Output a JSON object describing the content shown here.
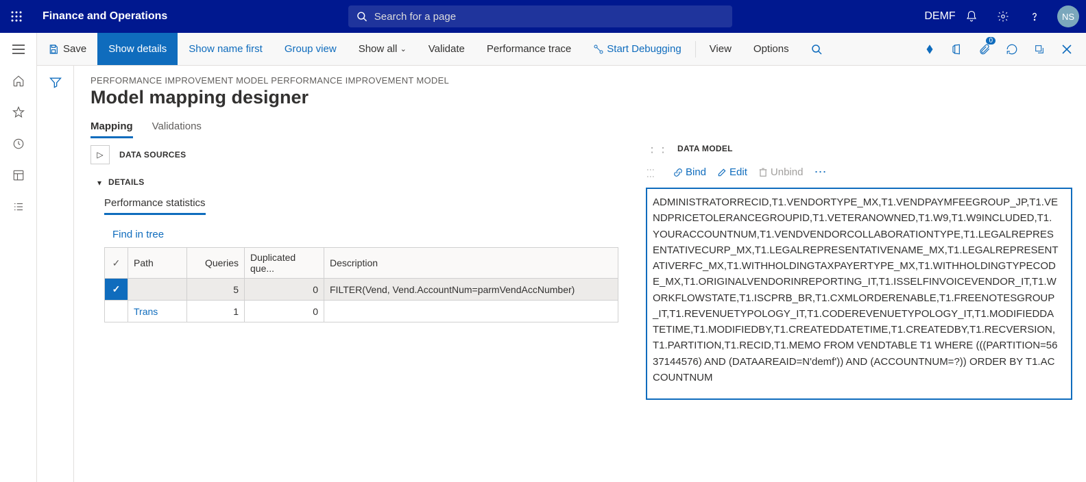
{
  "header": {
    "app_title": "Finance and Operations",
    "search_placeholder": "Search for a page",
    "company": "DEMF",
    "user_initials": "NS"
  },
  "commands": {
    "save": "Save",
    "show_details": "Show details",
    "show_name_first": "Show name first",
    "group_view": "Group view",
    "show_all": "Show all",
    "validate": "Validate",
    "perf_trace": "Performance trace",
    "start_debug": "Start Debugging",
    "view": "View",
    "options": "Options",
    "badge": "0"
  },
  "page": {
    "breadcrumb": "PERFORMANCE IMPROVEMENT MODEL PERFORMANCE IMPROVEMENT MODEL",
    "title": "Model mapping designer"
  },
  "tabs": {
    "mapping": "Mapping",
    "validations": "Validations"
  },
  "sections": {
    "data_sources": "DATA SOURCES",
    "details": "DETAILS",
    "perf_stats": "Performance statistics",
    "find_in_tree": "Find in tree"
  },
  "grid": {
    "headers": {
      "path": "Path",
      "queries": "Queries",
      "dup": "Duplicated que...",
      "desc": "Description"
    },
    "rows": [
      {
        "path": "",
        "queries": "5",
        "dup": "0",
        "desc": "FILTER(Vend, Vend.AccountNum=parmVendAccNumber)",
        "selected": true
      },
      {
        "path": "Trans",
        "queries": "1",
        "dup": "0",
        "desc": "",
        "selected": false
      }
    ]
  },
  "datamodel": {
    "title": "DATA MODEL",
    "bind": "Bind",
    "edit": "Edit",
    "unbind": "Unbind"
  },
  "sql": "ADMINISTRATORRECID,T1.VENDORTYPE_MX,T1.VENDPAYMFEEGROUP_JP,T1.VENDPRICETOLERANCEGROUPID,T1.VETERANOWNED,T1.W9,T1.W9INCLUDED,T1.YOURACCOUNTNUM,T1.VENDVENDORCOLLABORATIONTYPE,T1.LEGALREPRESENTATIVECURP_MX,T1.LEGALREPRESENTATIVENAME_MX,T1.LEGALREPRESENTATIVERFC_MX,T1.WITHHOLDINGTAXPAYERTYPE_MX,T1.WITHHOLDINGTYPECODE_MX,T1.ORIGINALVENDORINREPORTING_IT,T1.ISSELFINVOICEVENDOR_IT,T1.WORKFLOWSTATE,T1.ISCPRB_BR,T1.CXMLORDERENABLE,T1.FREENOTESGROUP_IT,T1.REVENUETYPOLOGY_IT,T1.CODEREVENUETYPOLOGY_IT,T1.MODIFIEDDATETIME,T1.MODIFIEDBY,T1.CREATEDDATETIME,T1.CREATEDBY,T1.RECVERSION,T1.PARTITION,T1.RECID,T1.MEMO FROM VENDTABLE T1 WHERE (((PARTITION=5637144576) AND (DATAAREAID=N'demf')) AND (ACCOUNTNUM=?)) ORDER BY T1.ACCOUNTNUM"
}
